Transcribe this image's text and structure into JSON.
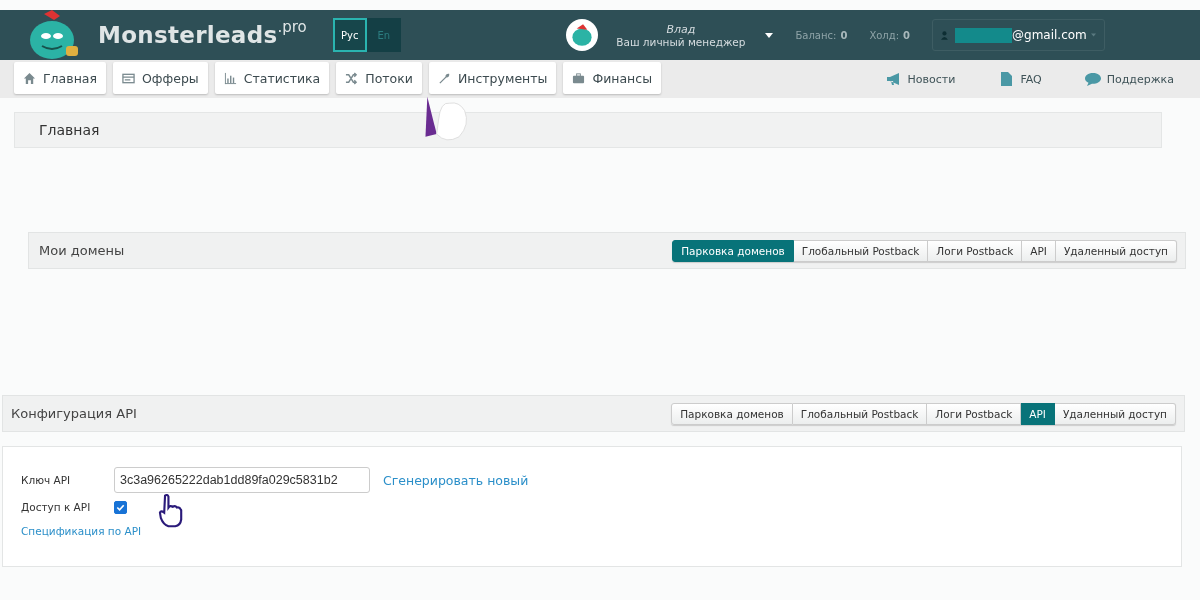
{
  "header": {
    "logo": "Monsterleads",
    "logo_suffix": ".pro",
    "languages": [
      {
        "label": "Рус",
        "selected": true
      },
      {
        "label": "En",
        "selected": false
      }
    ],
    "manager": {
      "name": "Влад",
      "role": "Ваш личный менеджер"
    },
    "balance": {
      "label": "Баланс:",
      "value": "0"
    },
    "hold": {
      "label": "Холд:",
      "value": "0"
    },
    "account": {
      "email": "@gmail.com"
    }
  },
  "nav": {
    "items": [
      {
        "label": "Главная"
      },
      {
        "label": "Офферы"
      },
      {
        "label": "Статистика"
      },
      {
        "label": "Потоки"
      },
      {
        "label": "Инструменты"
      },
      {
        "label": "Финансы"
      }
    ],
    "links": [
      {
        "label": "Новости"
      },
      {
        "label": "FAQ"
      },
      {
        "label": "Поддержка"
      }
    ]
  },
  "breadcrumb": "Главная",
  "domains_panel": {
    "title": "Мои домены",
    "tabs": [
      {
        "label": "Парковка доменов",
        "selected": true
      },
      {
        "label": "Глобальный Postback",
        "selected": false
      },
      {
        "label": "Логи Postback",
        "selected": false
      },
      {
        "label": "API",
        "selected": false
      },
      {
        "label": "Удаленный доступ",
        "selected": false
      }
    ]
  },
  "api_panel": {
    "title": "Конфигурация API",
    "tabs": [
      {
        "label": "Парковка доменов",
        "selected": false
      },
      {
        "label": "Глобальный Postback",
        "selected": false
      },
      {
        "label": "Логи Postback",
        "selected": false
      },
      {
        "label": "API",
        "selected": true
      },
      {
        "label": "Удаленный доступ",
        "selected": false
      }
    ],
    "key_label": "Ключ API",
    "key_value": "3c3a96265222dab1dd89fa029c5831b2",
    "generate_link": "Сгенерировать новый",
    "access_label": "Доступ к API",
    "access_checked": true,
    "spec_link": "Спецификация по API"
  }
}
